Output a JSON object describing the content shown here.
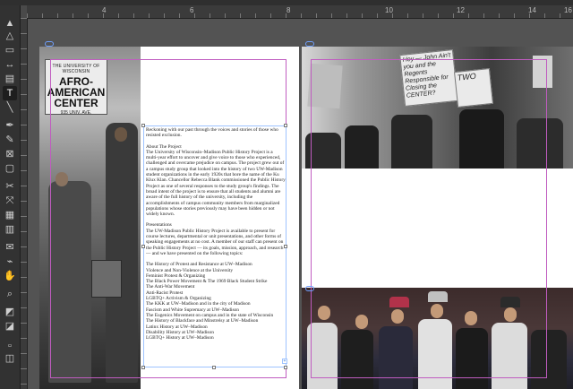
{
  "ruler": {
    "ticks_h": [
      "4",
      "6",
      "8",
      "10",
      "12",
      "14",
      "16"
    ]
  },
  "tools": [
    {
      "name": "selection-tool-icon"
    },
    {
      "name": "direct-selection-tool-icon"
    },
    {
      "name": "page-tool-icon"
    },
    {
      "name": "gap-tool-icon"
    },
    {
      "name": "content-collector-icon"
    },
    {
      "name": "type-tool-icon",
      "glyph": "T",
      "active": true
    },
    {
      "name": "line-tool-icon"
    },
    {
      "name": "pen-tool-icon"
    },
    {
      "name": "pencil-tool-icon"
    },
    {
      "name": "rectangle-frame-tool-icon"
    },
    {
      "name": "rectangle-tool-icon"
    },
    {
      "name": "scissors-tool-icon"
    },
    {
      "name": "free-transform-tool-icon"
    },
    {
      "name": "gradient-swatch-tool-icon"
    },
    {
      "name": "gradient-feather-tool-icon"
    },
    {
      "name": "note-tool-icon"
    },
    {
      "name": "eyedropper-tool-icon"
    },
    {
      "name": "hand-tool-icon"
    },
    {
      "name": "zoom-tool-icon"
    },
    {
      "name": "default-fill-stroke-icon"
    },
    {
      "name": "fill-stroke-swatch-icon"
    },
    {
      "name": "formatting-container-icon"
    },
    {
      "name": "apply-color-icon"
    }
  ],
  "images": {
    "left_sign": {
      "line1": "THE UNIVERSITY OF WISCONSIN",
      "line2": "AFRO-AMERICAN CENTER",
      "line3": "935 UNIV. AVE."
    },
    "protest_sign_1": "Hey — John Ain't you and the Regents Responsible for Closing the CENTER?",
    "protest_sign_2": "TWO"
  },
  "body_text": {
    "intro": "Reckoning with our past through the voices and stories of those who resisted exclusion.",
    "about_heading": "About The Project",
    "about_body": "The University of Wisconsin–Madison Public History Project is a multi-year effort to uncover and give voice to those who experienced, challenged and overcame prejudice on campus. The project grew out of a campus study group that looked into the history of two UW-Madison student organizations in the early 1920s that bore the name of the Ku Klux Klan. Chancellor Rebecca Blank commissioned the Public History Project as one of several responses to the study group's findings. The broad intent of the project is to ensure that all students and alumni are aware of the full history of the university, including the accomplishments of campus community members from marginalized populations whose stories previously may have been hidden or not widely known.",
    "presentations_heading": "Presentations",
    "presentations_body": "The UW-Madison Public History Project is available to present for course lectures, departmental or unit presentations, and other forms of speaking engagements at no cost. A member of our staff can present on the Public History Project — its goals, mission, approach, and research — and we have presented on the following topics:",
    "topics": [
      "The History of Protest and Resistance at UW–Madison",
      "Violence and Non-Violence at the University",
      "Feminist Protest & Organizing",
      "The Black Power Movement & The 1969 Black Student Strike",
      "The Anti-War Movement",
      "Anti-Racist Protest",
      "LGBTQ+ Activism & Organizing",
      "The KKK at UW–Madison and in the city of Madison",
      "Fascism and White Supremacy at UW–Madison",
      "The Eugenics Movement on campus and in the state of Wisconsin",
      "The History of Blackface and Minstrelsy at UW–Madison",
      "Latinx History at UW–Madison",
      "Disability History at UW–Madison",
      "LGBTQ+ History at UW–Madison"
    ]
  },
  "colors": {
    "accent_guide": "#c05cc0",
    "frame_select": "#9ec3ff",
    "active_tool": "#1e1e1e"
  }
}
